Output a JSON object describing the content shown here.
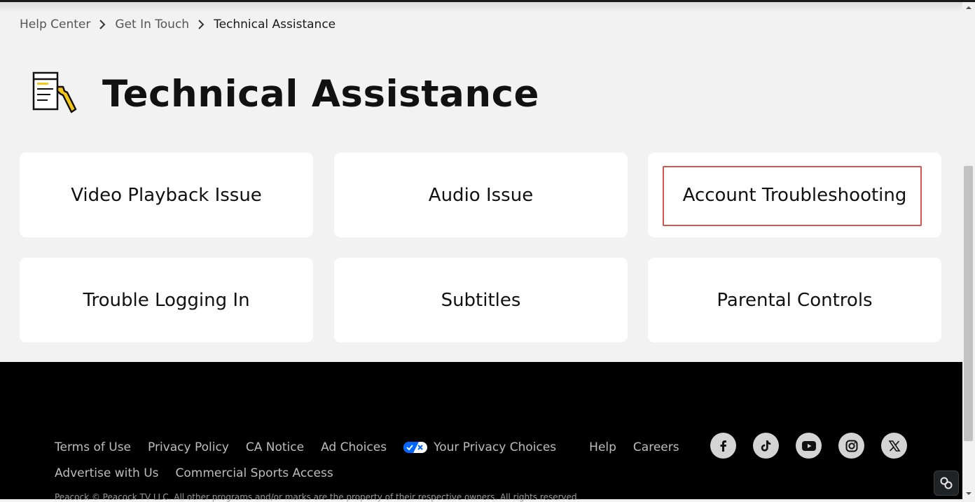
{
  "breadcrumb": {
    "items": [
      {
        "label": "Help Center"
      },
      {
        "label": "Get In Touch"
      },
      {
        "label": "Technical Assistance"
      }
    ]
  },
  "page": {
    "title": "Technical Assistance",
    "icon": "document-wrench-icon"
  },
  "topics": [
    {
      "label": "Video Playback Issue"
    },
    {
      "label": "Audio Issue"
    },
    {
      "label": "Account Troubleshooting",
      "highlighted": true
    },
    {
      "label": "Trouble Logging In"
    },
    {
      "label": "Subtitles"
    },
    {
      "label": "Parental Controls"
    }
  ],
  "footer": {
    "links_row1": [
      "Terms of Use",
      "Privacy Policy",
      "CA Notice",
      "Ad Choices",
      "Your Privacy Choices",
      "Help",
      "Careers"
    ],
    "links_row2": [
      "Advertise with Us",
      "Commercial Sports Access"
    ],
    "social": [
      "facebook-icon",
      "tiktok-icon",
      "youtube-icon",
      "instagram-icon",
      "x-icon"
    ],
    "copyright": "Peacock © Peacock TV LLC. All other programs and/or marks are the property of their respective owners. All rights reserved."
  },
  "colors": {
    "highlight_border": "#d9534f",
    "footer_bg": "#000000",
    "page_bg": "#f2f2f2",
    "icon_accent": "#f5c518"
  }
}
